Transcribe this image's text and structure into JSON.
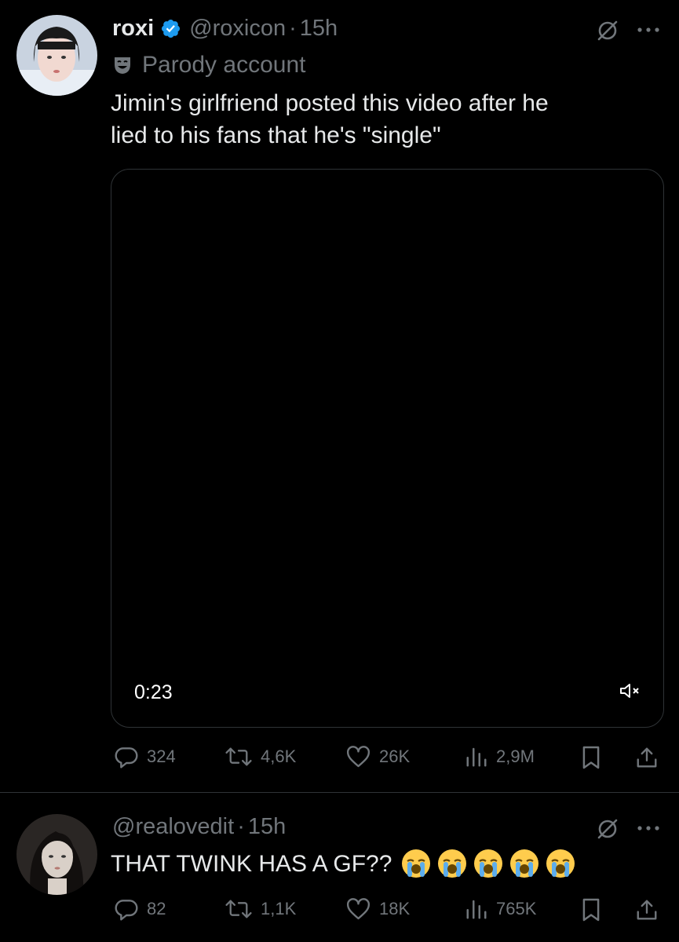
{
  "tweet": {
    "author_name": "roxi",
    "verified": true,
    "handle": "@roxicon",
    "separator": "·",
    "time": "15h",
    "parody_label": "Parody account",
    "text_line1": "Jimin's girlfriend posted this video after he",
    "text_line2": "lied to his fans that he's \"single\"",
    "video": {
      "duration": "0:23",
      "muted": true
    },
    "stats": {
      "replies": "324",
      "reposts": "4,6K",
      "likes": "26K",
      "views": "2,9M"
    }
  },
  "reply": {
    "handle": "@realovedit",
    "separator": "·",
    "time": "15h",
    "text": "THAT TWINK HAS A GF??",
    "emoji": [
      "😭",
      "😭",
      "😭",
      "😭",
      "😭"
    ],
    "stats": {
      "replies": "82",
      "reposts": "1,1K",
      "likes": "18K",
      "views": "765K"
    }
  },
  "colors": {
    "background": "#000000",
    "text_primary": "#e7e9ea",
    "text_secondary": "#71767b",
    "verified_blue": "#1d9bf0",
    "border": "#2f3336"
  },
  "icons": [
    "verified-badge-icon",
    "grok-icon",
    "more-icon",
    "parody-mask-icon",
    "mute-icon",
    "reply-icon",
    "repost-icon",
    "like-icon",
    "views-icon",
    "bookmark-icon",
    "share-icon",
    "loudly-crying-emoji"
  ]
}
